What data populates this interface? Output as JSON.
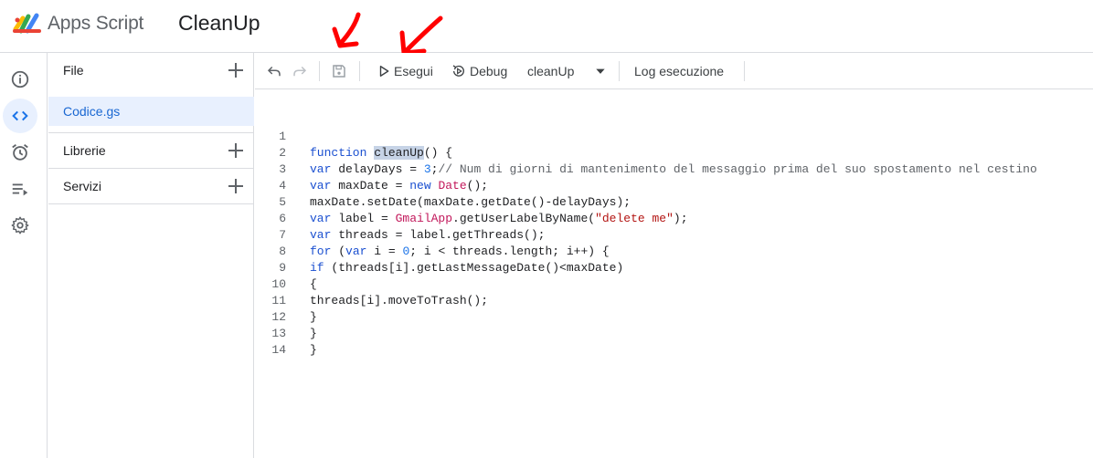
{
  "header": {
    "app_name": "Apps Script",
    "project_name": "CleanUp"
  },
  "rail": {
    "items": [
      {
        "name": "overview",
        "icon": "info-icon"
      },
      {
        "name": "editor",
        "icon": "code-icon",
        "active": true
      },
      {
        "name": "triggers",
        "icon": "alarm-clock-icon"
      },
      {
        "name": "executions",
        "icon": "executions-list-icon"
      },
      {
        "name": "settings",
        "icon": "gear-icon"
      }
    ]
  },
  "files_panel": {
    "files_label": "File",
    "files": [
      "Codice.gs"
    ],
    "libraries_label": "Librerie",
    "services_label": "Servizi"
  },
  "toolbar": {
    "run_label": "Esegui",
    "debug_label": "Debug",
    "function_selected": "cleanUp",
    "log_label": "Log esecuzione"
  },
  "editor": {
    "lines": [
      {
        "n": "1",
        "code": "function cleanUp() {"
      },
      {
        "n": "2",
        "code": "var delayDays = 3;// Num di giorni di mantenimento del messaggio prima del suo spostamento nel cestino"
      },
      {
        "n": "3",
        "code": "var maxDate = new Date();"
      },
      {
        "n": "4",
        "code": "maxDate.setDate(maxDate.getDate()-delayDays);"
      },
      {
        "n": "5",
        "code": "var label = GmailApp.getUserLabelByName(\"delete me\");"
      },
      {
        "n": "6",
        "code": "var threads = label.getThreads();"
      },
      {
        "n": "7",
        "code": "for (var i = 0; i < threads.length; i++) {"
      },
      {
        "n": "8",
        "code": "if (threads[i].getLastMessageDate()<maxDate)"
      },
      {
        "n": "9",
        "code": "{"
      },
      {
        "n": "10",
        "code": "threads[i].moveToTrash();"
      },
      {
        "n": "11",
        "code": "}"
      },
      {
        "n": "12",
        "code": "}"
      },
      {
        "n": "13",
        "code": "}"
      },
      {
        "n": "14",
        "code": ""
      }
    ]
  },
  "colors": {
    "accent": "#1a73e8",
    "active_bg": "#e8f0fe",
    "annotation": "#ff0000",
    "keyword": "#1a4fd0",
    "string": "#b31412",
    "type": "#c2185b"
  }
}
